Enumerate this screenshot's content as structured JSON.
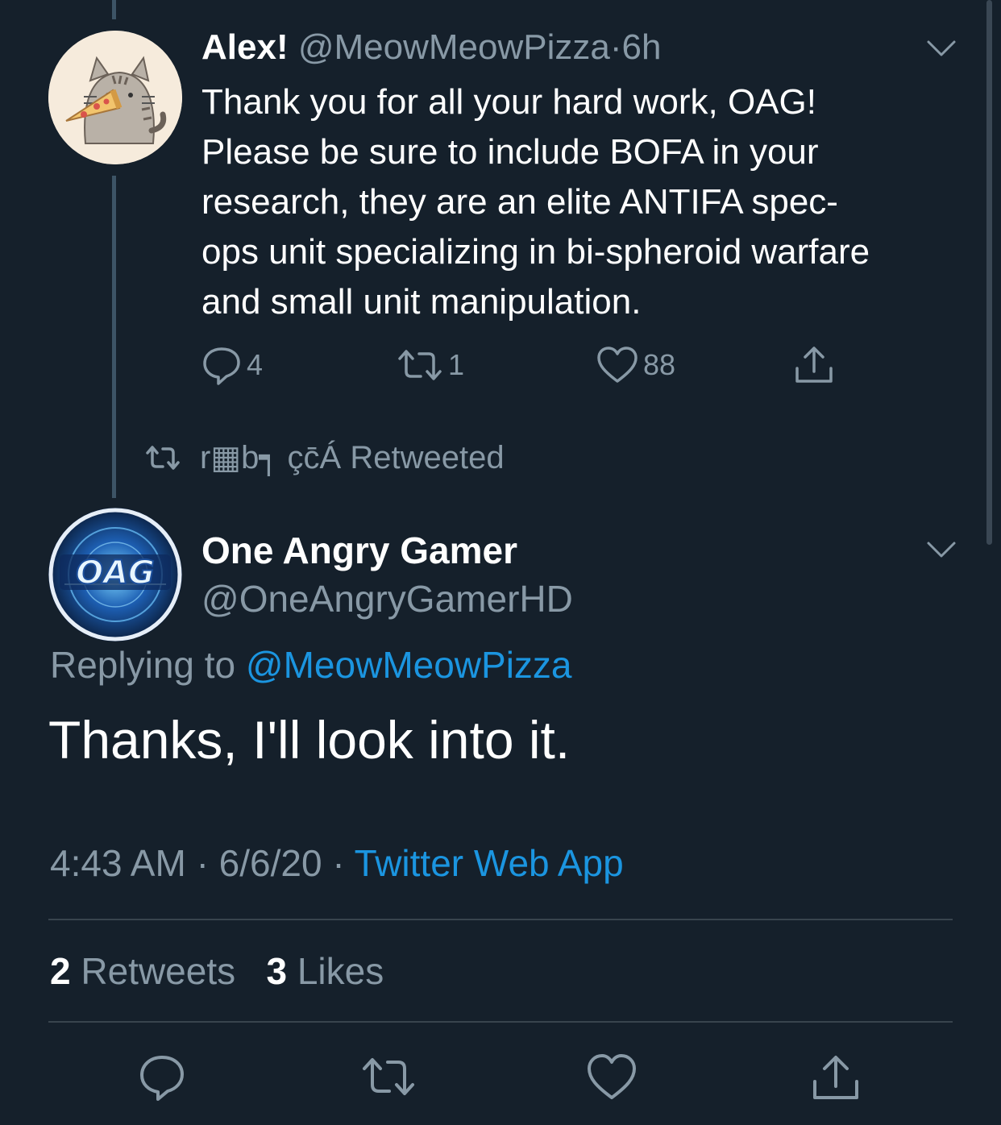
{
  "colors": {
    "background": "#15202b",
    "text_primary": "#ffffff",
    "text_muted": "#8899a6",
    "link": "#1b95e0",
    "divider": "#38444d"
  },
  "parent_tweet": {
    "display_name": "Alex!",
    "handle": "@MeowMeowPizza",
    "separator": "·",
    "time_ago": "6h",
    "text": "Thank you for all your hard work, OAG! Please be sure to include BOFA in your research, they are an elite ANTIFA spec-ops unit specializing in bi-spheroid warfare and small unit manipulation.",
    "text_lines": [
      "Thank you for all your hard work, OAG!",
      "Please be sure to include BOFA in your",
      "research, they are an elite ANTIFA spec-",
      "ops unit specializing in bi-spheroid warfare",
      "and small unit manipulation."
    ],
    "reply_count": "4",
    "retweet_count": "1",
    "like_count": "88",
    "avatar_icon": "pusheen-cat-pizza-avatar"
  },
  "retweet_context": {
    "retweeter": "r▦b┑ çc̄Á",
    "label": "Retweeted"
  },
  "main_tweet": {
    "display_name": "One Angry Gamer",
    "handle": "@OneAngryGamerHD",
    "replying_prefix": "Replying to",
    "replying_to": "@MeowMeowPizza",
    "text": "Thanks, I'll look into it.",
    "time": "4:43 AM",
    "date": "6/6/20",
    "separator": "·",
    "source": "Twitter Web App",
    "retweets_count": "2",
    "retweets_label": "Retweets",
    "likes_count": "3",
    "likes_label": "Likes",
    "avatar_icon": "oag-logo-avatar",
    "avatar_text": "OAG"
  }
}
